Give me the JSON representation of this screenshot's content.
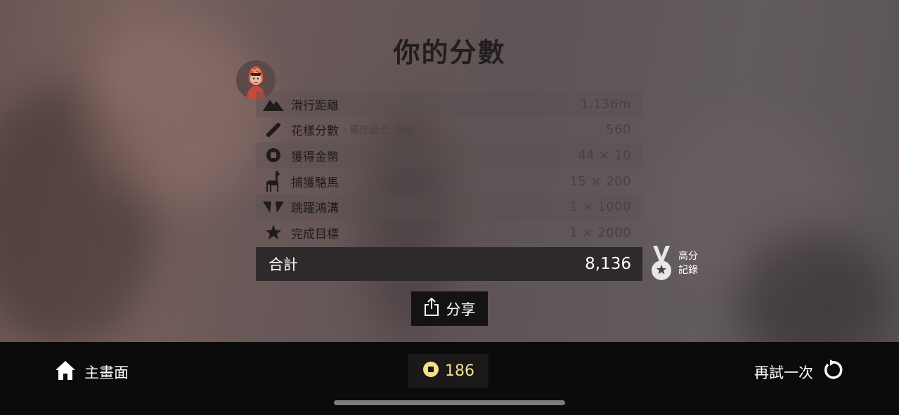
{
  "title": "你的分數",
  "rows": [
    {
      "icon": "mountain-icon",
      "label": "滑行距離",
      "sub": "",
      "value": "1,136m"
    },
    {
      "icon": "snowboard-icon",
      "label": "花樣分數",
      "sub": "- 最佳組合: 560",
      "value": "560"
    },
    {
      "icon": "coin-icon",
      "label": "獲得金幣",
      "sub": "",
      "value": "44 × 10"
    },
    {
      "icon": "llama-icon",
      "label": "捕獲駱馬",
      "sub": "",
      "value": "15 × 200"
    },
    {
      "icon": "chasm-icon",
      "label": "跳躍鴻溝",
      "sub": "",
      "value": "1 × 1000"
    },
    {
      "icon": "star-icon",
      "label": "完成目標",
      "sub": "",
      "value": "1 × 2000"
    }
  ],
  "total": {
    "label": "合計",
    "value": "8,136"
  },
  "high_score": {
    "line1": "高分",
    "line2": "記錄"
  },
  "share_label": "分享",
  "bottom": {
    "home_label": "主畫面",
    "coins": "186",
    "retry_label": "再試一次"
  },
  "colors": {
    "coin": "#f3e08a",
    "bottom_bar": "#0c0b0b"
  }
}
